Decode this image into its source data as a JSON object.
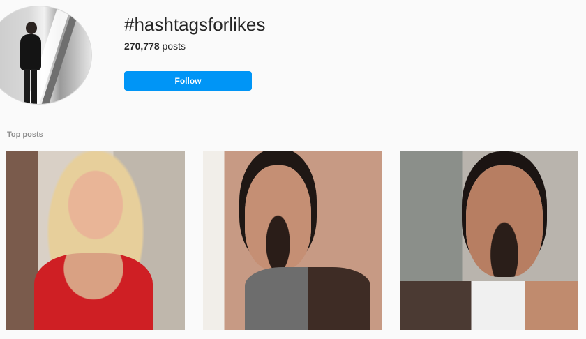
{
  "hashtag": "#hashtagsforlikes",
  "post_count": "270,778",
  "post_count_suffix": " posts",
  "follow_label": "Follow",
  "section_label": "Top posts",
  "colors": {
    "accent": "#0095f6",
    "background": "#fafafa",
    "muted_text": "#8e8e8e"
  },
  "posts": [
    {
      "name": "post-1"
    },
    {
      "name": "post-2"
    },
    {
      "name": "post-3"
    }
  ]
}
